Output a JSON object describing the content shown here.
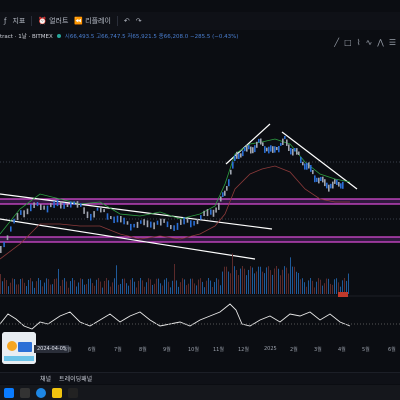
{
  "toolbar": {
    "items": [
      {
        "name": "indicators-button",
        "label": "지표",
        "icon": "fx-icon"
      },
      {
        "name": "alert-button",
        "label": "얼러트",
        "icon": "alarm-icon"
      },
      {
        "name": "replay-button",
        "label": "리플레이",
        "icon": "replay-icon"
      }
    ]
  },
  "symbol": {
    "title": "tract · 1날 · BITMEX",
    "ohlc": "시66,493.5  고66,747.5  저65,921.5  종66,208.0  −285.5 (−0.43%)"
  },
  "time_axis": {
    "labels": [
      "5월",
      "6월",
      "7월",
      "8월",
      "9월",
      "10월",
      "11월",
      "12월",
      "2025",
      "2월",
      "3월",
      "4월",
      "5월",
      "6월"
    ],
    "cursor_date": "2024-04-05"
  },
  "bottom_tabs": [
    "채널",
    "트레이딩패널"
  ],
  "colors": {
    "bg": "#0b0d12",
    "up": "#2b6fd6",
    "down": "#9ea3ad",
    "band_pink": "#d94bd6",
    "trend": "#ffffff",
    "channel": "#3fb950"
  }
}
